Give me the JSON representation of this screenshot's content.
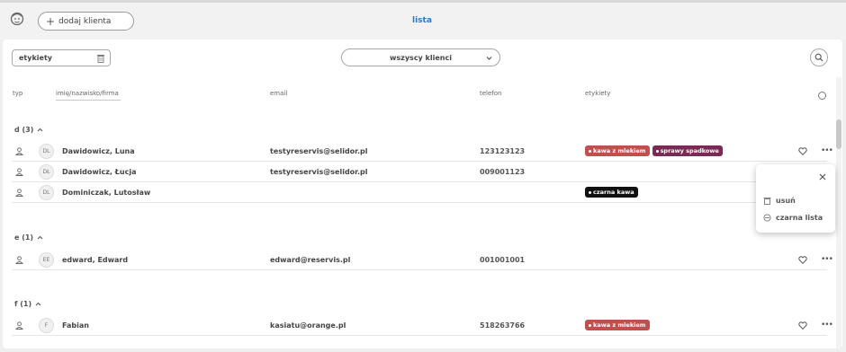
{
  "topbar": {
    "add_client_label": "dodaj klienta",
    "active_tab": "lista"
  },
  "filters": {
    "tags_label": "etykiety",
    "client_filter_label": "wszyscy klienci"
  },
  "table_headers": {
    "type": "typ",
    "name_placeholder": "imię/nazwisko/firma",
    "email": "email",
    "phone": "telefon",
    "tags": "etykiety"
  },
  "groups": [
    {
      "label": "d (3)",
      "rows": [
        {
          "initials": "DL",
          "name": "Dawidowicz, Luna",
          "email": "testyreservis@selidor.pl",
          "phone": "123123123",
          "tags": [
            {
              "label": "kawa z mlekiem",
              "color": "#c0504d"
            },
            {
              "label": "sprawy spadkowe",
              "color": "#7b2a55"
            }
          ]
        },
        {
          "initials": "DŁ",
          "name": "Dawidowicz, Łucja",
          "email": "testyreservis@selidor.pl",
          "phone": "009001123",
          "tags": []
        },
        {
          "initials": "DL",
          "name": "Dominiczak, Lutosław",
          "email": "",
          "phone": "",
          "tags": [
            {
              "label": "czarna kawa",
              "color": "#111111"
            }
          ]
        }
      ]
    },
    {
      "label": "e (1)",
      "rows": [
        {
          "initials": "EE",
          "name": "edward, Edward",
          "email": "edward@reservis.pl",
          "phone": "001001001",
          "tags": []
        }
      ]
    },
    {
      "label": "f (1)",
      "rows": [
        {
          "initials": "F",
          "name": "Fabian",
          "email": "kasiatu@orange.pl",
          "phone": "518263766",
          "tags": [
            {
              "label": "kawa z mlekiem",
              "color": "#c0504d"
            }
          ]
        }
      ]
    }
  ],
  "context_menu": {
    "delete_label": "usuń",
    "blacklist_label": "czarna lista"
  },
  "colors": {
    "accent": "#2a78c4"
  }
}
